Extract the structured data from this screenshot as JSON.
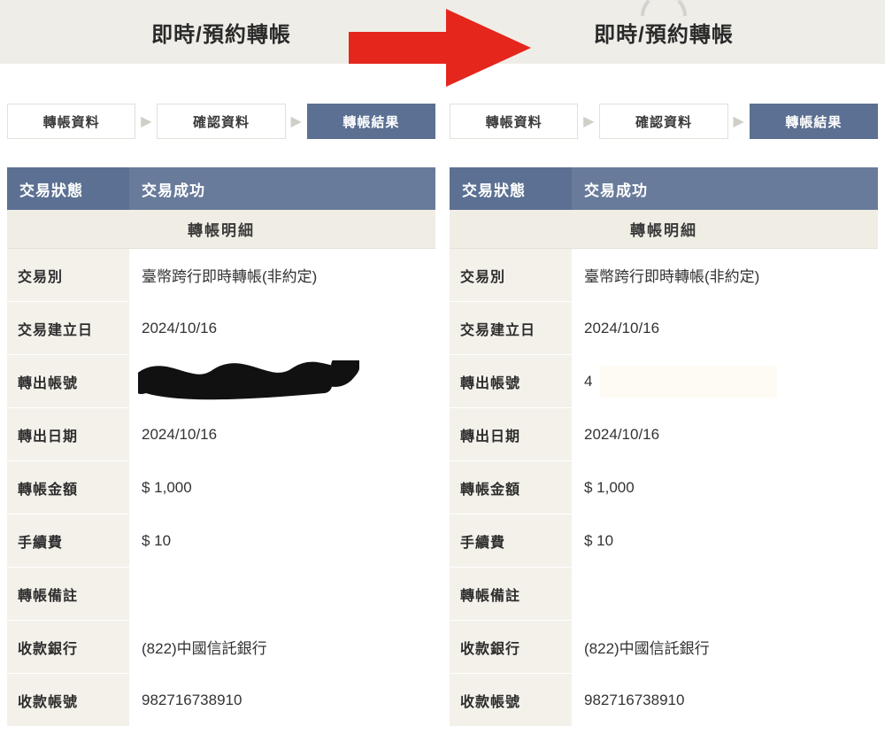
{
  "left": {
    "title": "即時/預約轉帳",
    "steps": [
      "轉帳資料",
      "確認資料",
      "轉帳結果"
    ],
    "status_label": "交易狀態",
    "status_value": "交易成功",
    "section_title": "轉帳明細",
    "rows": [
      {
        "label": "交易別",
        "value": "臺幣跨行即時轉帳(非約定)"
      },
      {
        "label": "交易建立日",
        "value": "2024/10/16"
      },
      {
        "label": "轉出帳號",
        "value": ""
      },
      {
        "label": "轉出日期",
        "value": "2024/10/16"
      },
      {
        "label": "轉帳金額",
        "value": "$ 1,000"
      },
      {
        "label": "手續費",
        "value": "$ 10"
      },
      {
        "label": "轉帳備註",
        "value": ""
      },
      {
        "label": "收款銀行",
        "value": "(822)中國信託銀行"
      },
      {
        "label": "收款帳號",
        "value": "982716738910"
      }
    ]
  },
  "right": {
    "title": "即時/預約轉帳",
    "steps": [
      "轉帳資料",
      "確認資料",
      "轉帳結果"
    ],
    "status_label": "交易狀態",
    "status_value": "交易成功",
    "section_title": "轉帳明細",
    "rows": [
      {
        "label": "交易別",
        "value": "臺幣跨行即時轉帳(非約定)"
      },
      {
        "label": "交易建立日",
        "value": "2024/10/16"
      },
      {
        "label": "轉出帳號",
        "value": "4"
      },
      {
        "label": "轉出日期",
        "value": "2024/10/16"
      },
      {
        "label": "轉帳金額",
        "value": "$ 1,000"
      },
      {
        "label": "手續費",
        "value": "$ 10"
      },
      {
        "label": "轉帳備註",
        "value": ""
      },
      {
        "label": "收款銀行",
        "value": "(822)中國信託銀行"
      },
      {
        "label": "收款帳號",
        "value": "982716738910"
      }
    ]
  }
}
